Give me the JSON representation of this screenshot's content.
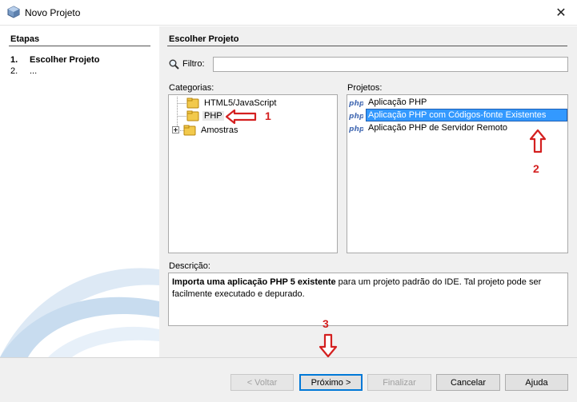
{
  "window": {
    "title": "Novo Projeto",
    "close_glyph": "✕",
    "icon": "netbeans-cube-icon"
  },
  "steps_panel": {
    "heading": "Etapas",
    "steps": [
      {
        "num": "1.",
        "label": "Escolher Projeto",
        "active": true
      },
      {
        "num": "2.",
        "label": "...",
        "active": false
      }
    ]
  },
  "main": {
    "heading": "Escolher Projeto",
    "filter": {
      "label": "Filtro:",
      "value": "",
      "icon": "search-icon"
    },
    "categories": {
      "label": "Categorias:",
      "items": [
        {
          "label": "HTML5/JavaScript",
          "expandable": false
        },
        {
          "label": "PHP",
          "expandable": false,
          "selected": true
        },
        {
          "label": "Amostras",
          "expandable": true
        }
      ]
    },
    "projects": {
      "label": "Projetos:",
      "items": [
        {
          "label": "Aplicação PHP",
          "selected": false
        },
        {
          "label": "Aplicação PHP com Códigos-fonte Existentes",
          "selected": true
        },
        {
          "label": "Aplicação PHP de Servidor Remoto",
          "selected": false
        }
      ]
    },
    "description": {
      "label": "Descrição:",
      "bold": "Importa uma aplicação PHP 5 existente",
      "rest": " para um projeto padrão do IDE. Tal projeto pode ser facilmente executado e depurado."
    }
  },
  "annotations": {
    "a1": "1",
    "a2": "2",
    "a3": "3"
  },
  "buttons": {
    "back": "< Voltar",
    "next": "Próximo >",
    "finish": "Finalizar",
    "cancel": "Cancelar",
    "help": "Ajuda"
  },
  "colors": {
    "selection": "#3399ff",
    "annotation": "#d42020"
  }
}
